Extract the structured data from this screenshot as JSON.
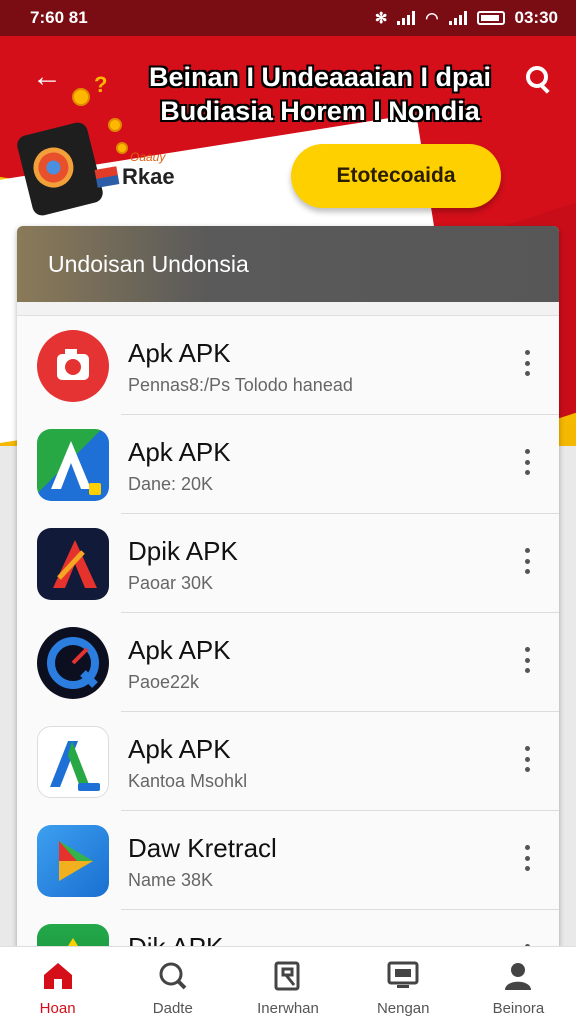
{
  "status_bar": {
    "time": "7:60 81",
    "clock": "03:30"
  },
  "header": {
    "title_line1": "Beinan I Undeaaaian I dpai",
    "title_line2": "Budiasia Horem I Nondia",
    "brand_small": "Oaauy",
    "brand_name": "Rkae",
    "cta_label": "Etotecoaida"
  },
  "card": {
    "title": "Undoisan Undonsia",
    "apps": [
      {
        "name": "Apk APK",
        "meta": "Pennas8:/Ps Tolodo hanead",
        "icon": "camera-app-icon"
      },
      {
        "name": "Apk APK",
        "meta": "Dane: 20K",
        "icon": "triangle-a-app-icon"
      },
      {
        "name": "Dpik APK",
        "meta": "Paoar 30K",
        "icon": "red-a-app-icon"
      },
      {
        "name": "Apk APK",
        "meta": "Paoe22k",
        "icon": "gauge-app-icon"
      },
      {
        "name": "Apk APK",
        "meta": "Kantoa Msohkl",
        "icon": "white-a-app-icon"
      },
      {
        "name": "Daw Kretracl",
        "meta": "Name 38K",
        "icon": "play-app-icon"
      },
      {
        "name": "Dik APK",
        "meta": "",
        "icon": "green-app-icon"
      }
    ]
  },
  "bottom_nav": [
    {
      "label": "Hoan",
      "icon": "home-icon",
      "active": true
    },
    {
      "label": "Dadte",
      "icon": "search-icon",
      "active": false
    },
    {
      "label": "Inerwhan",
      "icon": "bookmark-icon",
      "active": false
    },
    {
      "label": "Nengan",
      "icon": "tv-icon",
      "active": false
    },
    {
      "label": "Beinora",
      "icon": "profile-icon",
      "active": false
    }
  ],
  "colors": {
    "brand_red": "#d40f1a",
    "brand_yellow": "#f7c600",
    "card_header": "#575757"
  }
}
